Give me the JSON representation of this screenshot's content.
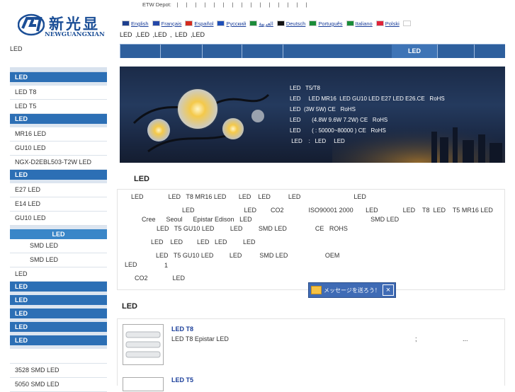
{
  "logo": {
    "cn": "新光显",
    "en": "NEWGUANGXIAN"
  },
  "etw": {
    "label": "ETW Depot:",
    "separators": [
      "|",
      "|",
      "|",
      "|",
      "|",
      "|",
      "|",
      "|",
      "|",
      "|",
      "|",
      "|",
      "|",
      "|",
      "|"
    ]
  },
  "languages": [
    {
      "label": "English",
      "flag": "#1d3f8e"
    },
    {
      "label": "Français",
      "flag": "#2447a8"
    },
    {
      "label": "Español",
      "flag": "#d42b1e"
    },
    {
      "label": "Русский",
      "flag": "#1e4fb8"
    },
    {
      "label": "العربية",
      "flag": "#1c8b3a"
    },
    {
      "label": "Deutsch",
      "flag": "#111111"
    },
    {
      "label": "Português",
      "flag": "#1a8d38"
    },
    {
      "label": "Italiano",
      "flag": "#1a8d38"
    },
    {
      "label": "Polski",
      "flag": "#e0243a"
    },
    {
      "label": "",
      "flag": "#ffffff"
    }
  ],
  "header_links": "LED ,LED    ,LED ,    LED    ,LED",
  "left_label": "LED",
  "nav": {
    "active": "LED"
  },
  "sidebar": {
    "groups": [
      {
        "head": "LED",
        "items": [
          "LED   T8",
          "LED   T5"
        ]
      },
      {
        "head": "LED",
        "items": [
          "MR16 LED",
          "GU10 LED",
          "NGX-D2EBL503-T2W LED"
        ]
      },
      {
        "head": "LED",
        "items": [
          "E27 LED",
          "E14 LED",
          "GU10 LED"
        ],
        "sub": {
          "head": "LED",
          "items": [
            "SMD LED",
            "SMD LED"
          ]
        },
        "after": [
          "LED"
        ]
      },
      {
        "head": "LED",
        "items": []
      },
      {
        "head": "LED",
        "items": []
      },
      {
        "head": "LED",
        "items": []
      },
      {
        "head": "LED",
        "items": []
      },
      {
        "head": "LED",
        "items": [
          "",
          "3528 SMD LED",
          "5050 SMD LED"
        ]
      }
    ]
  },
  "banner": {
    "lines": [
      "LED   T5/T8",
      "LED     LED MR16  LED GU10 LED E27 LED E26.CE   RoHS",
      "LED  (3W 5W) CE   RoHS",
      "LED       (4.8W 9.6W 7.2W) CE   RoHS",
      "LED       ( : 50000~80000 ) CE   RoHS",
      " LED    :   LED     LED"
    ]
  },
  "intro": {
    "title": "LED",
    "lines": [
      "LED              LED   T8 MR16 LED       LED    LED          LED                              LED",
      "LED                            LED        CO2              ISO90001 2000       LED              LED    T8  LED    T5 MR16 LED",
      "Cree      Seoul      Epistar Edison   LED                                                                   SMD LED",
      "LED   T5 GU10 LED         LED         SMD LED                CE   ROHS",
      "LED    LED        LED   LED         LED",
      "LED   T5 GU10 LED         LED          SMD LED                     OEM",
      "1",
      "CO2              LED"
    ],
    "lone": "LED"
  },
  "message_button": {
    "label": "メッセージを送ろう！",
    "close": "×"
  },
  "products": {
    "title": "LED",
    "items": [
      {
        "title": "LED     T8",
        "desc": "LED   T8     Epistar                           LED",
        "extra1": ";",
        "extra2": "..."
      },
      {
        "title": "LED     T5"
      }
    ]
  }
}
